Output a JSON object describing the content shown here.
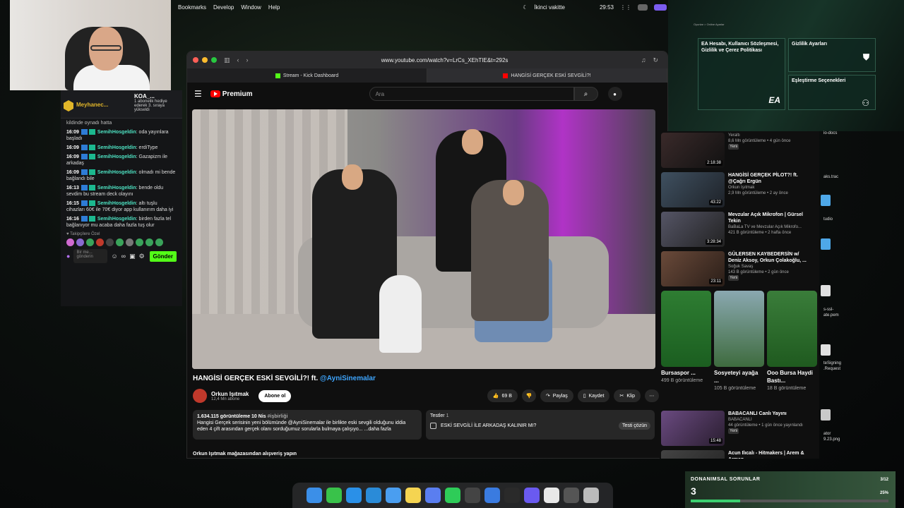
{
  "menubar": {
    "items": [
      "Bookmarks",
      "Develop",
      "Window",
      "Help"
    ],
    "status": "İkinci vakitte",
    "clock": "29:53"
  },
  "chat": {
    "pinned_name": "Meyhanec...",
    "pinned_user": "KOA_...",
    "pinned_text": "1 abonelik hediye ederek 3. sıraya yükseldi",
    "partial_line": "kildinde oynadı hatta",
    "messages": [
      {
        "time": "16:09",
        "user": "SemihHosgeldin",
        "text": ": oda yayınlara başladı"
      },
      {
        "time": "16:09",
        "user": "SemihHosgeldin",
        "text": ": erdiType"
      },
      {
        "time": "16:09",
        "user": "SemihHosgeldin",
        "text": ": Gazapizm ile arkadaş"
      },
      {
        "time": "16:09",
        "user": "SemihHosgeldin",
        "text": ": olmadı mi bende bağlandı bile"
      },
      {
        "time": "16:13",
        "user": "SemihHosgeldin",
        "text": ": bende oldu sevdim bu stream deck olayını"
      },
      {
        "time": "16:15",
        "user": "SemihHosgeldin",
        "text": ": altı tuşlu cihazları 60€ ile 70€ diyor app kullanırım daha iyi"
      },
      {
        "time": "16:16",
        "user": "SemihHosgeldin",
        "text": ": birden fazla tel bağlanıyor mu acaba daha fazla tuş olur"
      }
    ],
    "followers_label": "Takipçilere Özel",
    "input_placeholder": "Bir me... gönderin",
    "send_label": "Gönder"
  },
  "browser": {
    "url": "www.youtube.com/watch?v=LrCs_XEhTIE&t=292s",
    "tabs": [
      "Stream - Kick Dashboard",
      "HANGİSİ GERÇEK ESKİ SEVGİLİ?!"
    ]
  },
  "youtube": {
    "logo": "Premium",
    "search_placeholder": "Ara",
    "video_title": "HANGİSİ GERÇEK ESKİ SEVGİLİ?! ft.",
    "video_title_tag": "@AyniSinemalar",
    "channel_name": "Orkun Işıtmak",
    "channel_subs": "12,4 Mn abone",
    "subscribe_label": "Abone ol",
    "likes": "69 B",
    "share_label": "Paylaş",
    "save_label": "Kaydet",
    "clip_label": "Klip",
    "desc_stats": "1.634.115 görüntüleme  10 Nis",
    "desc_hashtag": "#işbirliği",
    "desc_text": "Hangisi Gerçek serisinin yeni bölümünde @AyniSinemalar ile birlikte eski sevgili olduğunu iddia eden 4 çift arasından gerçek olanı sorduğumuz sorularla bulmaya çalışıyo... ...daha fazla",
    "quiz_title": "Testler",
    "quiz_count": "1",
    "quiz_item": "ESKİ SEVGİLİ İLE ARKADAŞ KALINIR MI?",
    "quiz_button": "Testi çözün",
    "store_label": "Orkun Işıtmak mağazasından alışveriş yapın"
  },
  "recs": [
    {
      "title": "",
      "channel": "Yeraltı",
      "meta": "8,6 Mn görüntüleme • 4 gün önce",
      "badge": "Yeni",
      "duration": "2:18:38"
    },
    {
      "title": "HANGİSİ GERÇEK PİLOT?! ft. @Çağrı Ergün",
      "channel": "Orkun Işıtmak",
      "meta": "2,9 Mn görüntüleme • 2 ay önce",
      "badge": "",
      "duration": "43:22"
    },
    {
      "title": "Mevzular Açık Mikrofon | Gürsel Tekin",
      "channel": "BaBaLa TV ve Mevzular Açık Mikrofo...",
      "meta": "421 B görüntüleme • 2 hafta önce",
      "badge": "",
      "duration": "3:28:34"
    },
    {
      "title": "GÜLERSEN KAYBEDERSİN w/ Deniz Aksoy, Orkun Çolakoğlu, ...",
      "channel": "Soğuk Savaş",
      "meta": "143 B görüntüleme • 2 gün önce",
      "badge": "Yeni",
      "duration": "23:11"
    }
  ],
  "shorts": [
    {
      "title": "Bursaspor ...",
      "views": "499 B görüntüleme"
    },
    {
      "title": "Sosyeteyi ayağa ...",
      "views": "105 B görüntüleme"
    },
    {
      "title": "Ooo Bursa Haydi Bastı...",
      "views": "18 B görüntüleme"
    }
  ],
  "recs2": [
    {
      "title": "BABACANLI Canlı Yayını",
      "channel": "BABACANLI",
      "meta": "44 görüntüleme • 1 gün önce yayınlandı",
      "badge": "Yeni",
      "duration": "15:48"
    },
    {
      "title": "Acun Ilıcalı - Hitmakers | Arem & Arman",
      "channel": "",
      "meta": "",
      "badge": "",
      "duration": ""
    }
  ],
  "ea": {
    "breadcrumb": "Oyunlar > Online Ayarlar",
    "tile1": "EA Hesabı, Kullanıcı Sözleşmesi, Gizlilik ve Çerez Politikası",
    "tile2": "Gizlilik Ayarları",
    "tile3": "Eşleştirme Seçenekleri",
    "logo": "EA"
  },
  "desktop_files": [
    "io-docs",
    "aks.trac",
    "tudio",
    "s-ssl-",
    "ate.pem",
    "teSigning",
    ".Request",
    "ator",
    "9.23.png"
  ],
  "hw_widget": {
    "title": "DONANIMSAL SORUNLAR",
    "count": "3",
    "fraction": "3/12",
    "percent_label": "25%",
    "progress": 0.25
  }
}
